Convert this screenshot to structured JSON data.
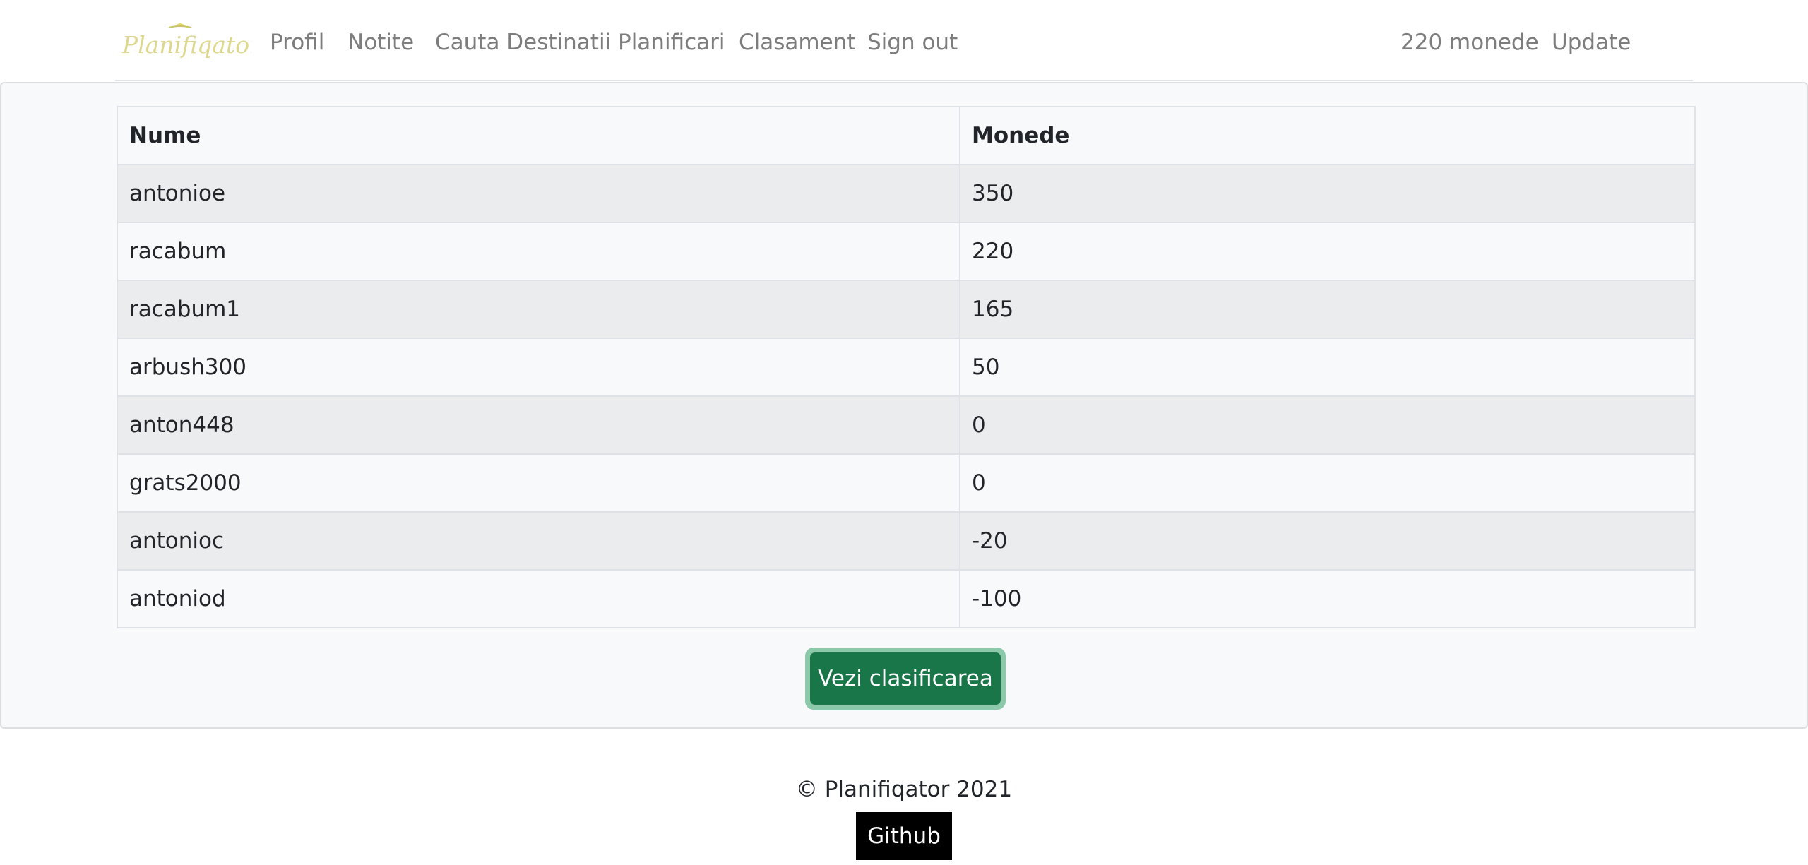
{
  "brand": {
    "name": "Planifiqator",
    "accent_color": "#ddd88e",
    "sun_color": "#e3d86a"
  },
  "nav": {
    "links": [
      {
        "label": "Profil"
      },
      {
        "label": "Notite"
      },
      {
        "label": "Cauta Destinatii"
      },
      {
        "label": "Planificari"
      },
      {
        "label": "Clasament"
      },
      {
        "label": "Sign out"
      }
    ],
    "coins": "220 monede",
    "update": "Update"
  },
  "table": {
    "headers": [
      "Nume",
      "Monede"
    ],
    "rows": [
      [
        "antonioe",
        "350"
      ],
      [
        "racabum",
        "220"
      ],
      [
        "racabum1",
        "165"
      ],
      [
        "arbush300",
        "50"
      ],
      [
        "anton448",
        "0"
      ],
      [
        "grats2000",
        "0"
      ],
      [
        "antonioc",
        "-20"
      ],
      [
        "antoniod",
        "-100"
      ]
    ]
  },
  "actions": {
    "view_ranking": "Vezi clasificarea",
    "primary_color": "#187648"
  },
  "footer": {
    "copyright": "© Planifiqator 2021",
    "github": "Github"
  }
}
